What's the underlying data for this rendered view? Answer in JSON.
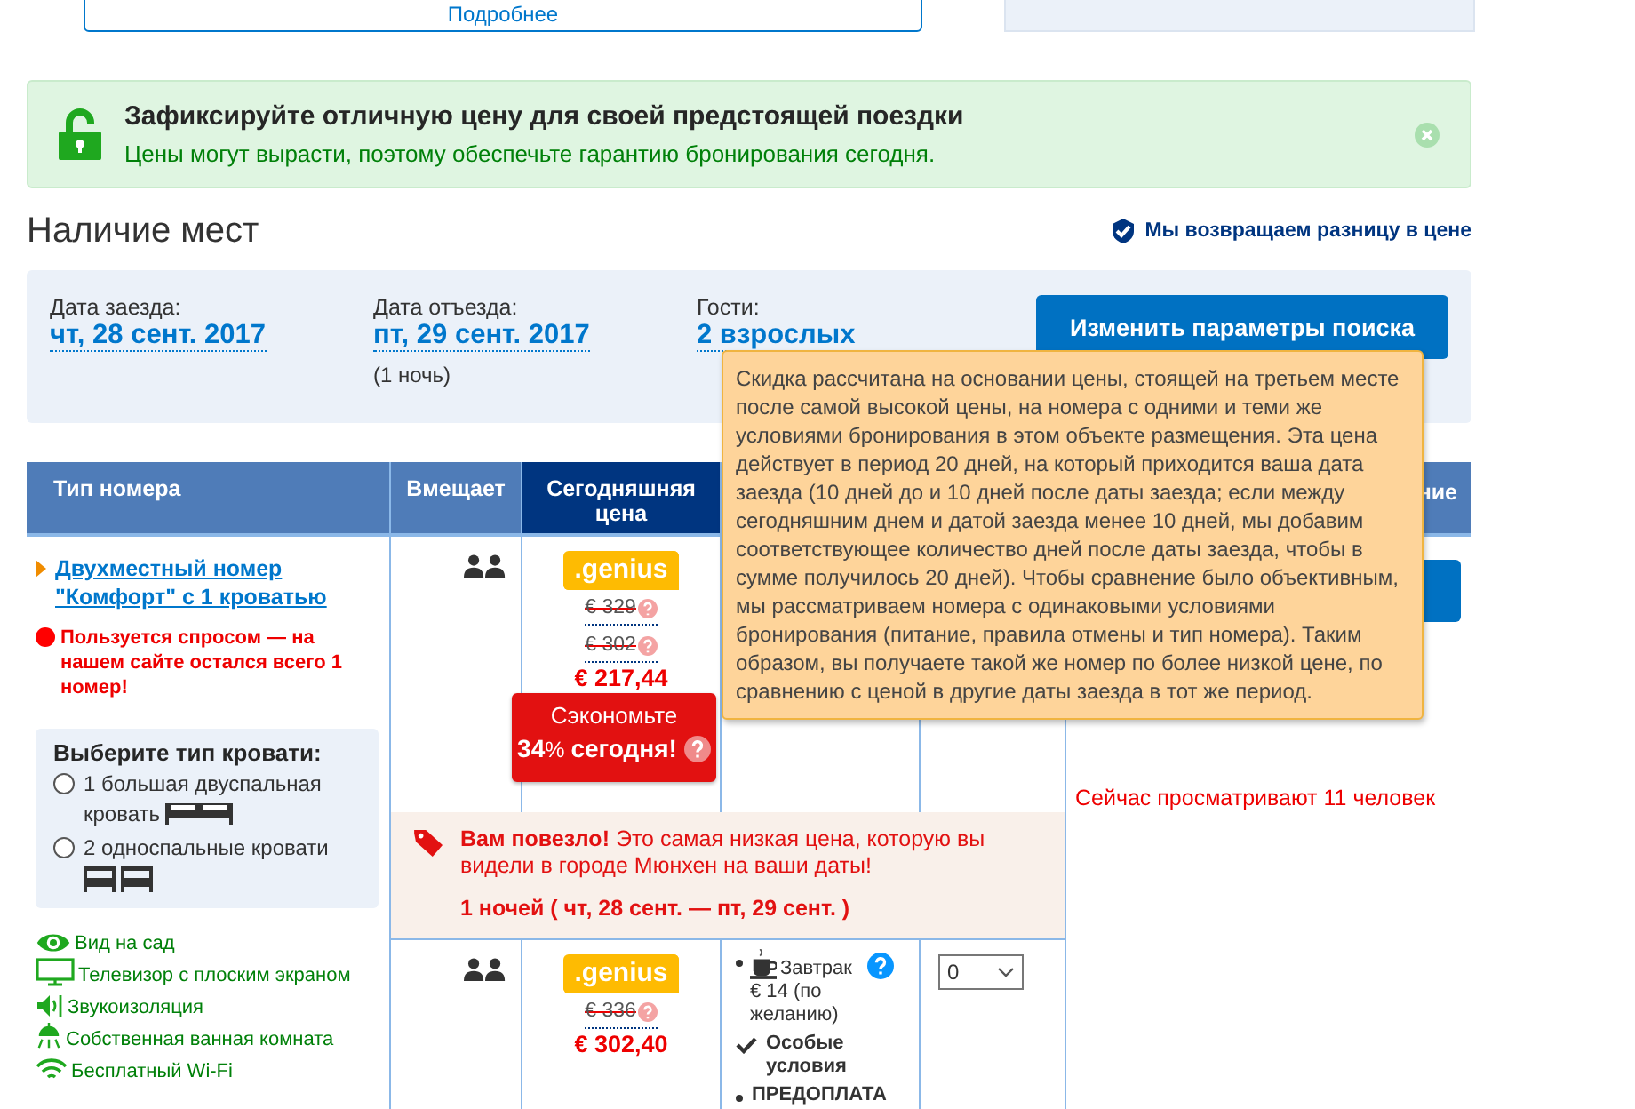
{
  "top_bar": {
    "more_button": "Подробнее"
  },
  "promo_banner": {
    "title": "Зафиксируйте отличную цену для своей предстоящей поездки",
    "text": "Цены могут вырасти, поэтому обеспечьте гарантию бронирования сегодня."
  },
  "availability": {
    "heading": "Наличие мест",
    "price_match": "Мы возвращаем разницу в цене"
  },
  "search_summary": {
    "fields": [
      {
        "label": "Дата заезда:",
        "value": "чт, 28 сент. 2017"
      },
      {
        "label": "Дата отъезда:",
        "value": "пт, 29 сент. 2017",
        "note": "(1 ночь)"
      },
      {
        "label": "Гости:",
        "value": "2 взрослых"
      }
    ],
    "button": "Изменить параметры поиска"
  },
  "tooltip": {
    "text": "Скидка рассчитана на основании цены, стоящей на третьем месте после самой высокой цены, на номера с одними и теми же условиями бронирования в этом объекте размещения. Эта цена действует в период 20 дней, на который приходится ваша дата заезда (10 дней до и 10 дней после даты заезда; если между сегодняшним днем и датой заезда менее 10 дней, мы добавим соответствующее количество дней после даты заезда, чтобы в сумме получилось 20 дней). Чтобы сравнение было объективным, мы рассматриваем номера с одинаковыми условиями бронирования (питание, правила отмены и тип номера). Таким образом, вы получаете такой же номер по более низкой цене, по сравнению с ценой в другие даты заезда в тот же период."
  },
  "table": {
    "columns": [
      {
        "label": "Тип номера",
        "highlighted": false
      },
      {
        "label": "Вмещает",
        "highlighted": false
      },
      {
        "label": "Сегодняшняя цена",
        "highlighted": true
      },
      {
        "label": "ние",
        "highlighted": false
      }
    ],
    "room": {
      "name": "Двухместный номер \"Комфорт\" с 1 кроватью",
      "demand": "Пользуется спросом — на нашем сайте остался всего 1 номер!",
      "bed_choice": {
        "title": "Выберите тип кровати:",
        "options": [
          {
            "label": "1 большая двуспальная кровать",
            "kind": "double",
            "selected": false
          },
          {
            "label": "2 односпальные кровати",
            "kind": "twin",
            "selected": false
          }
        ]
      },
      "facilities": [
        {
          "label": "Вид на сад",
          "kind": "view"
        },
        {
          "label": "Телевизор с плоским экраном",
          "kind": "tv"
        },
        {
          "label": "Звукоизоляция",
          "kind": "sound"
        },
        {
          "label": "Собственная ванная комната",
          "kind": "shower"
        },
        {
          "label": "Бесплатный Wi-Fi",
          "kind": "wifi"
        }
      ]
    },
    "offers": [
      {
        "badge": ".genius",
        "old_prices": [
          {
            "text": "€ 329",
            "struck": true
          },
          {
            "text": "€ 302",
            "struck": true
          }
        ],
        "price": "€ 217,44",
        "savings": {
          "label": "Сэкономьте",
          "amount": "**34**% **сегодня!**"
        },
        "watching": "Сейчас просматривают 11 человек",
        "deal": {
          "text": "**Вам повезло!** Это самая низкая цена, которую вы видели в городе Мюнхен на ваши даты!",
          "stay": "1 ночей ( чт, 28 сент. — пт, 29 сент. )"
        }
      },
      {
        "badge": ".genius",
        "old_prices": [
          {
            "text": "€ 336",
            "struck": true
          }
        ],
        "price": "€ 302,40",
        "meal": "Завтрак € 14 (по желанию)",
        "conditions": [
          {
            "label": "Особые условия",
            "kind": "check"
          },
          {
            "label": "ПРЕДОПЛАТА",
            "kind": "bullet"
          }
        ],
        "quantity": "0"
      }
    ]
  }
}
